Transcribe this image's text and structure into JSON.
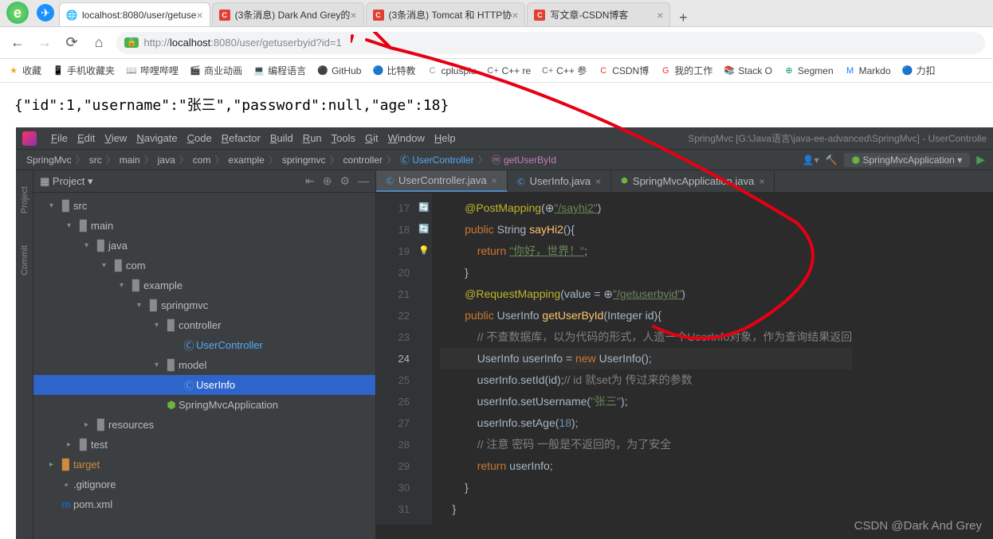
{
  "browser": {
    "tabs": [
      {
        "favicon": "globe",
        "title": "localhost:8080/user/getuse",
        "active": true
      },
      {
        "favicon": "csdn",
        "title": "(3条消息) Dark And Grey的",
        "active": false
      },
      {
        "favicon": "csdn",
        "title": "(3条消息) Tomcat 和 HTTP协",
        "active": false
      },
      {
        "favicon": "csdn",
        "title": "写文章-CSDN博客",
        "active": false
      }
    ],
    "url_display": "http://localhost:8080/user/getuserbyid?id=1",
    "bookmarks": [
      {
        "icon": "★",
        "label": "收藏",
        "color": "#f5a623"
      },
      {
        "icon": "📱",
        "label": "手机收藏夹",
        "color": "#4caf50"
      },
      {
        "icon": "📖",
        "label": "哔哩哔哩",
        "color": "#00a1d6"
      },
      {
        "icon": "🎬",
        "label": "商业动画",
        "color": "#e91e63"
      },
      {
        "icon": "💻",
        "label": "编程语言",
        "color": "#666"
      },
      {
        "icon": "⚫",
        "label": "GitHub",
        "color": "#000"
      },
      {
        "icon": "🔵",
        "label": "比特教",
        "color": "#1e88e5"
      },
      {
        "icon": "C",
        "label": "cplusplu",
        "color": "#999"
      },
      {
        "icon": "C+",
        "label": "C++ re",
        "color": "#666"
      },
      {
        "icon": "C+",
        "label": "C++ 参",
        "color": "#666"
      },
      {
        "icon": "C",
        "label": "CSDN博",
        "color": "#e33e33"
      },
      {
        "icon": "G",
        "label": "我的工作",
        "color": "#e33e33"
      },
      {
        "icon": "📚",
        "label": "Stack O",
        "color": "#f48024"
      },
      {
        "icon": "⊕",
        "label": "Segmen",
        "color": "#009a61"
      },
      {
        "icon": "M",
        "label": "Markdo",
        "color": "#0084ff"
      },
      {
        "icon": "🔵",
        "label": "力扣",
        "color": "#ffa116"
      }
    ]
  },
  "response_body": "{\"id\":1,\"username\":\"张三\",\"password\":null,\"age\":18}",
  "ide": {
    "title": "SpringMvc [G:\\Java语言\\java-ee-advanced\\SpringMvc] - UserControlle",
    "menu": [
      "File",
      "Edit",
      "View",
      "Navigate",
      "Code",
      "Refactor",
      "Build",
      "Run",
      "Tools",
      "Git",
      "Window",
      "Help"
    ],
    "breadcrumbs": [
      "SpringMvc",
      "src",
      "main",
      "java",
      "com",
      "example",
      "springmvc",
      "controller"
    ],
    "breadcrumb_class": "UserController",
    "breadcrumb_method": "getUserById",
    "run_config": "SpringMvcApplication",
    "side_tabs": [
      "Project",
      "Commit"
    ],
    "tree_title": "Project",
    "tree": [
      {
        "indent": 0,
        "arrow": "▾",
        "icon": "folder",
        "label": "src"
      },
      {
        "indent": 1,
        "arrow": "▾",
        "icon": "folder",
        "label": "main"
      },
      {
        "indent": 2,
        "arrow": "▾",
        "icon": "folder",
        "label": "java"
      },
      {
        "indent": 3,
        "arrow": "▾",
        "icon": "folder",
        "label": "com"
      },
      {
        "indent": 4,
        "arrow": "▾",
        "icon": "folder",
        "label": "example"
      },
      {
        "indent": 5,
        "arrow": "▾",
        "icon": "folder",
        "label": "springmvc"
      },
      {
        "indent": 6,
        "arrow": "▾",
        "icon": "folder",
        "label": "controller"
      },
      {
        "indent": 7,
        "arrow": "",
        "icon": "class",
        "label": "UserController"
      },
      {
        "indent": 6,
        "arrow": "▾",
        "icon": "folder",
        "label": "model"
      },
      {
        "indent": 7,
        "arrow": "",
        "icon": "class",
        "label": "UserInfo",
        "selected": true
      },
      {
        "indent": 6,
        "arrow": "",
        "icon": "spring",
        "label": "SpringMvcApplication"
      },
      {
        "indent": 2,
        "arrow": "▸",
        "icon": "folder",
        "label": "resources"
      },
      {
        "indent": 1,
        "arrow": "▸",
        "icon": "folder",
        "label": "test"
      },
      {
        "indent": 0,
        "arrow": "▸",
        "icon": "folder-orange",
        "label": "target"
      },
      {
        "indent": 0,
        "arrow": "",
        "icon": "file",
        "label": ".gitignore"
      },
      {
        "indent": 0,
        "arrow": "",
        "icon": "maven",
        "label": "pom.xml"
      }
    ],
    "editor_tabs": [
      {
        "icon": "class",
        "label": "UserController.java",
        "active": true
      },
      {
        "icon": "class",
        "label": "UserInfo.java",
        "active": false
      },
      {
        "icon": "spring",
        "label": "SpringMvcApplication.java",
        "active": false
      }
    ],
    "line_start": 17,
    "line_end": 31,
    "highlight_line": 24,
    "code_lines": [
      {
        "n": 17,
        "html": "        <span class='a'>@PostMapping</span>(<span class='p'>⊕</span><span class='su'>\"/sayhi2\"</span>)"
      },
      {
        "n": 18,
        "html": "        <span class='k'>public</span> <span class='t'>String</span> <span class='m'>sayHi2</span>(){",
        "icon": "🔄"
      },
      {
        "n": 19,
        "html": "            <span class='k'>return</span> <span class='su'>\"你好，世界！\"</span>;"
      },
      {
        "n": 20,
        "html": "        }"
      },
      {
        "n": 21,
        "html": "        <span class='a'>@RequestMapping</span>(value = <span class='p'>⊕</span><span class='su'>\"/getuserbyid\"</span>)"
      },
      {
        "n": 22,
        "html": "        <span class='k'>public</span> <span class='t'>UserInfo</span> <span class='m'>getUserById</span>(<span class='t'>Integer</span> <span class='p'>id</span>){",
        "icon": "🔄"
      },
      {
        "n": 23,
        "html": "            <span class='c'>// 不查数据库，以为代码的形式，人造一个UserInfo对象，作为查询结果返回</span>"
      },
      {
        "n": 24,
        "html": "            <span class='t'>UserInfo</span> userInfo = <span class='k'>new</span> <span class='t'>UserInfo</span>();",
        "hl": true,
        "icon": "💡"
      },
      {
        "n": 25,
        "html": "            userInfo.setId(id);<span class='c'>// id 就set为 传过来的参数</span>"
      },
      {
        "n": 26,
        "html": "            userInfo.setUsername(<span class='s'>\"张三\"</span>);"
      },
      {
        "n": 27,
        "html": "            userInfo.setAge(<span class='n'>18</span>);"
      },
      {
        "n": 28,
        "html": "            <span class='c'>// 注意 密码 一般是不返回的，为了安全</span>"
      },
      {
        "n": 29,
        "html": "            <span class='k'>return</span> userInfo;"
      },
      {
        "n": 30,
        "html": "        }"
      },
      {
        "n": 31,
        "html": "    }"
      }
    ],
    "watermark": "CSDN @Dark And Grey"
  }
}
